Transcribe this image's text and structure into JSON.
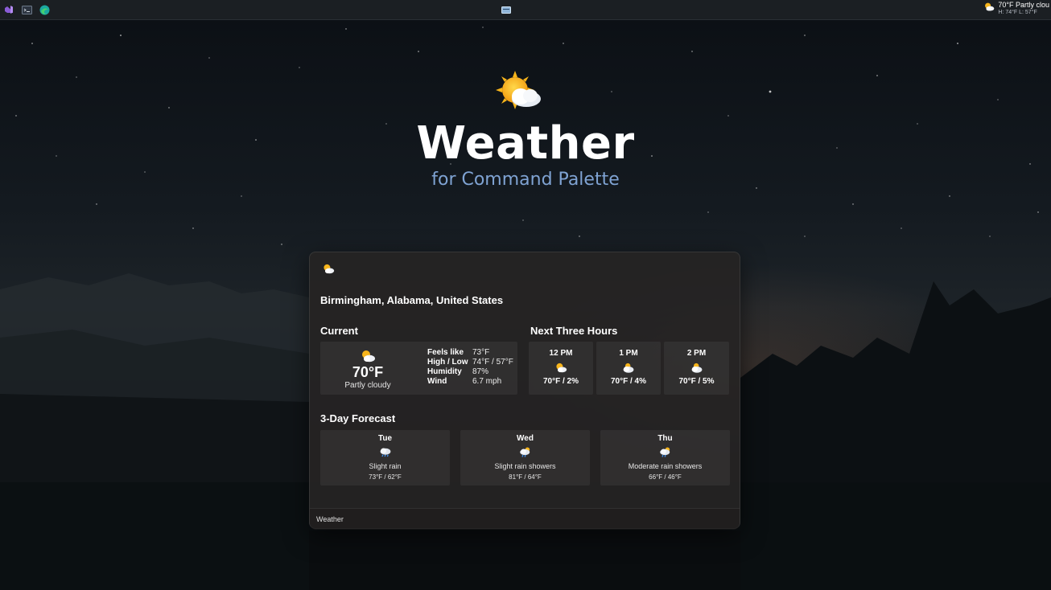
{
  "colors": {
    "accent_subtitle": "#7fa3d3",
    "card_background": "#262424",
    "taskbar_background": "#1b1f23"
  },
  "taskbar": {
    "left_icons": [
      "visual-studio-icon",
      "terminal-icon",
      "edge-icon"
    ],
    "center_icon": "window-icon",
    "weather_widget": {
      "icon": "partly-cloudy-icon",
      "temp_text": "70°F Partly clou",
      "high_low_text": "H: 74°F  L: 57°F"
    }
  },
  "hero": {
    "icon": "partly-cloudy-icon",
    "title": "Weather",
    "subtitle": "for Command Palette"
  },
  "card": {
    "top_icon": "partly-cloudy-icon",
    "location": "Birmingham, Alabama, United States",
    "current": {
      "section_title": "Current",
      "icon": "partly-cloudy-icon",
      "temperature": "70°F",
      "condition": "Partly cloudy",
      "details": [
        {
          "label": "Feels like",
          "value": "73°F"
        },
        {
          "label": "High / Low",
          "value": "74°F / 57°F"
        },
        {
          "label": "Humidity",
          "value": "87%"
        },
        {
          "label": "Wind",
          "value": "6.7 mph"
        }
      ]
    },
    "next_hours": {
      "section_title": "Next Three Hours",
      "hours": [
        {
          "time": "12 PM",
          "icon": "partly-cloudy-icon",
          "value": "70°F / 2%"
        },
        {
          "time": "1 PM",
          "icon": "cloudy-sun-icon",
          "value": "70°F / 4%"
        },
        {
          "time": "2 PM",
          "icon": "cloudy-sun-icon",
          "value": "70°F / 5%"
        }
      ]
    },
    "forecast": {
      "section_title": "3-Day Forecast",
      "days": [
        {
          "day": "Tue",
          "icon": "rain-cloud-icon",
          "condition": "Slight rain",
          "range": "73°F / 62°F"
        },
        {
          "day": "Wed",
          "icon": "sun-rain-cloud-icon",
          "condition": "Slight rain showers",
          "range": "81°F / 64°F"
        },
        {
          "day": "Thu",
          "icon": "sun-rain-cloud-icon",
          "condition": "Moderate rain showers",
          "range": "66°F / 46°F"
        }
      ]
    },
    "footer_label": "Weather"
  }
}
